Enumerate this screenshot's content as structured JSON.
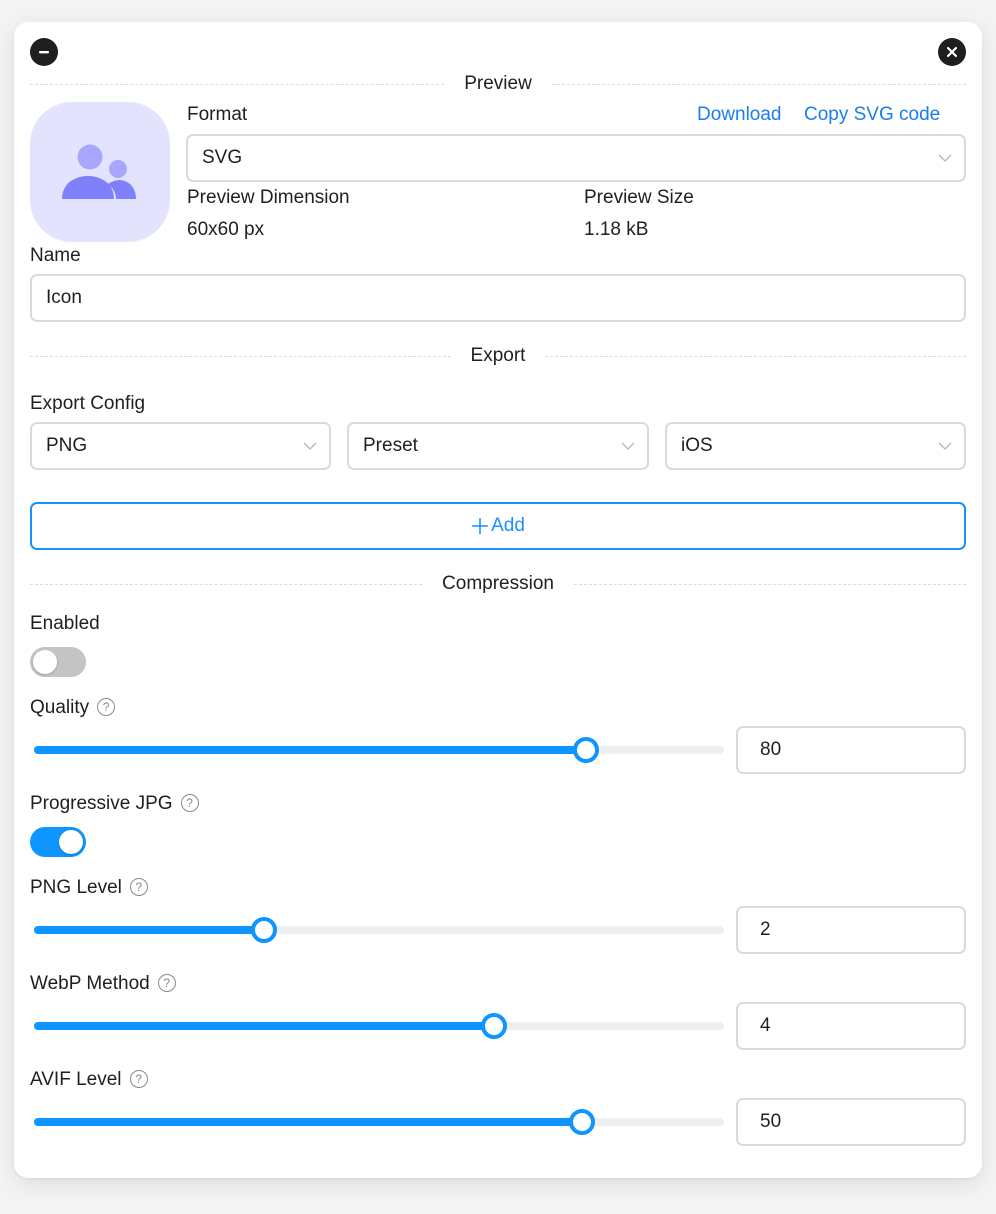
{
  "window": {
    "minimize_icon": "minus-circle-icon",
    "close_icon": "close-circle-icon"
  },
  "preview": {
    "section_title": "Preview",
    "icon_name": "users-group-icon",
    "icon_colors": {
      "background": "#e3e3fd",
      "primary": "#8080fb",
      "secondary": "#a7a7fd"
    },
    "format_label": "Format",
    "download_label": "Download",
    "copy_svg_label": "Copy SVG code",
    "format_value": "SVG",
    "dimension_label": "Preview Dimension",
    "dimension_value": "60x60 px",
    "size_label": "Preview Size",
    "size_value": "1.18 kB"
  },
  "name": {
    "label": "Name",
    "value": "Icon"
  },
  "export": {
    "section_title": "Export",
    "config_label": "Export Config",
    "configs": [
      {
        "value": "PNG"
      },
      {
        "value": "Preset"
      },
      {
        "value": "iOS"
      }
    ],
    "add_label": "Add"
  },
  "compression": {
    "section_title": "Compression",
    "enabled": {
      "label": "Enabled",
      "on": false
    },
    "quality": {
      "label": "Quality",
      "value": 80,
      "min": 0,
      "max": 100
    },
    "progressive_jpg": {
      "label": "Progressive JPG",
      "on": true
    },
    "png_level": {
      "label": "PNG Level",
      "value": 2,
      "min": 0,
      "max": 6
    },
    "webp_method": {
      "label": "WebP Method",
      "value": 4,
      "min": 0,
      "max": 6
    },
    "avif_level": {
      "label": "AVIF Level",
      "value": 50,
      "min": 0,
      "max": 63
    }
  },
  "colors": {
    "accent": "#0e95ff",
    "link": "#1a7ef0",
    "toggle_off": "#c4c4c4"
  }
}
